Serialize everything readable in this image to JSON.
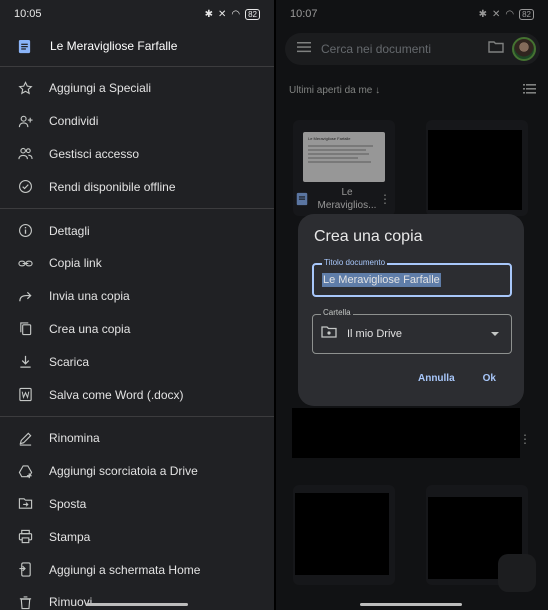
{
  "left": {
    "status": {
      "time": "10:05",
      "battery": "82"
    },
    "doc_title": "Le Meravigliose Farfalle",
    "group1": [
      {
        "label": "Aggiungi a Speciali",
        "icon": "star-icon"
      },
      {
        "label": "Condividi",
        "icon": "person-add-icon"
      },
      {
        "label": "Gestisci accesso",
        "icon": "people-icon"
      },
      {
        "label": "Rendi disponibile offline",
        "icon": "offline-check-icon"
      }
    ],
    "group2": [
      {
        "label": "Dettagli",
        "icon": "info-icon"
      },
      {
        "label": "Copia link",
        "icon": "link-icon"
      },
      {
        "label": "Invia una copia",
        "icon": "forward-icon"
      },
      {
        "label": "Crea una copia",
        "icon": "copy-icon"
      },
      {
        "label": "Scarica",
        "icon": "download-icon"
      },
      {
        "label": "Salva come Word (.docx)",
        "icon": "word-icon"
      }
    ],
    "group3": [
      {
        "label": "Rinomina",
        "icon": "pencil-icon"
      },
      {
        "label": "Aggiungi scorciatoia a Drive",
        "icon": "drive-shortcut-icon"
      },
      {
        "label": "Sposta",
        "icon": "move-folder-icon"
      },
      {
        "label": "Stampa",
        "icon": "print-icon"
      },
      {
        "label": "Aggiungi a schermata Home",
        "icon": "home-screen-icon"
      },
      {
        "label": "Rimuovi",
        "icon": "trash-icon"
      }
    ]
  },
  "right": {
    "status": {
      "time": "10:07",
      "battery": "82"
    },
    "search_placeholder": "Cerca nei documenti",
    "section_label": "Ultimi aperti da me",
    "file1_name_line1": "Le",
    "file1_name_line2": "Meraviglios...",
    "thumb_title": "Le Meravigliose Farfalle",
    "dialog": {
      "title": "Crea una copia",
      "doc_title_label": "Titolo documento",
      "doc_title_value": "Le Meravigliose Farfalle",
      "folder_label": "Cartella",
      "folder_value": "Il mio Drive",
      "cancel_label": "Annulla",
      "ok_label": "Ok"
    }
  },
  "colors": {
    "accent": "#a8c7fa",
    "doc_blue": "#8ab4f8",
    "panel": "#2c2d31",
    "selection": "#5f7da8"
  }
}
